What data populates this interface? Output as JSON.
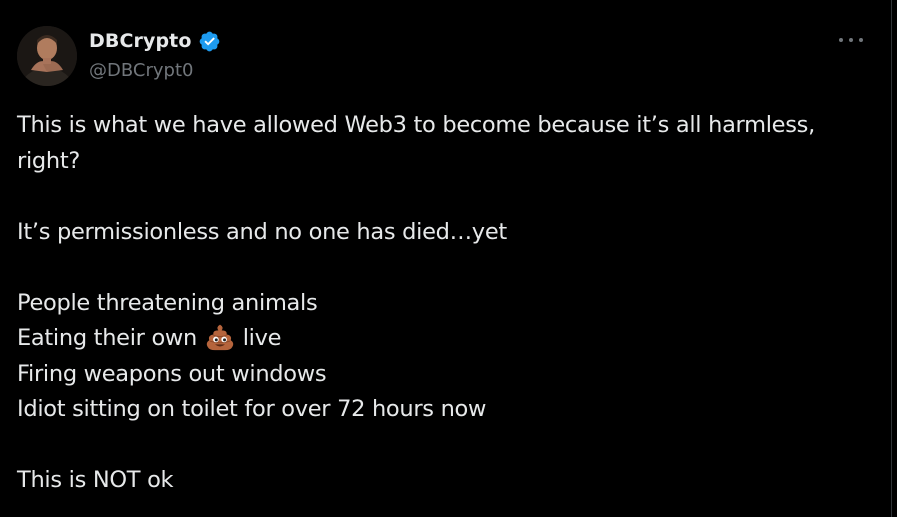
{
  "author": {
    "display_name": "DBCrypto",
    "handle": "@DBCrypt0",
    "verified": true
  },
  "colors": {
    "background": "#000000",
    "text": "#e7e9ea",
    "secondary": "#71767b",
    "verified": "#1d9bf0"
  },
  "tweet": {
    "para1_line1": "This is what we have allowed Web3 to become because it’s all harmless,",
    "para1_line2": "right?",
    "para2": "It’s permissionless and no one has died…yet",
    "list_1": "People threatening animals",
    "list_2_before": "Eating their own",
    "list_2_emoji": "pile-of-poo-emoji",
    "list_2_after": "live",
    "list_3": "Firing weapons out windows",
    "list_4": "Idiot sitting on toilet for over 72 hours now",
    "closing": "This is NOT ok"
  }
}
